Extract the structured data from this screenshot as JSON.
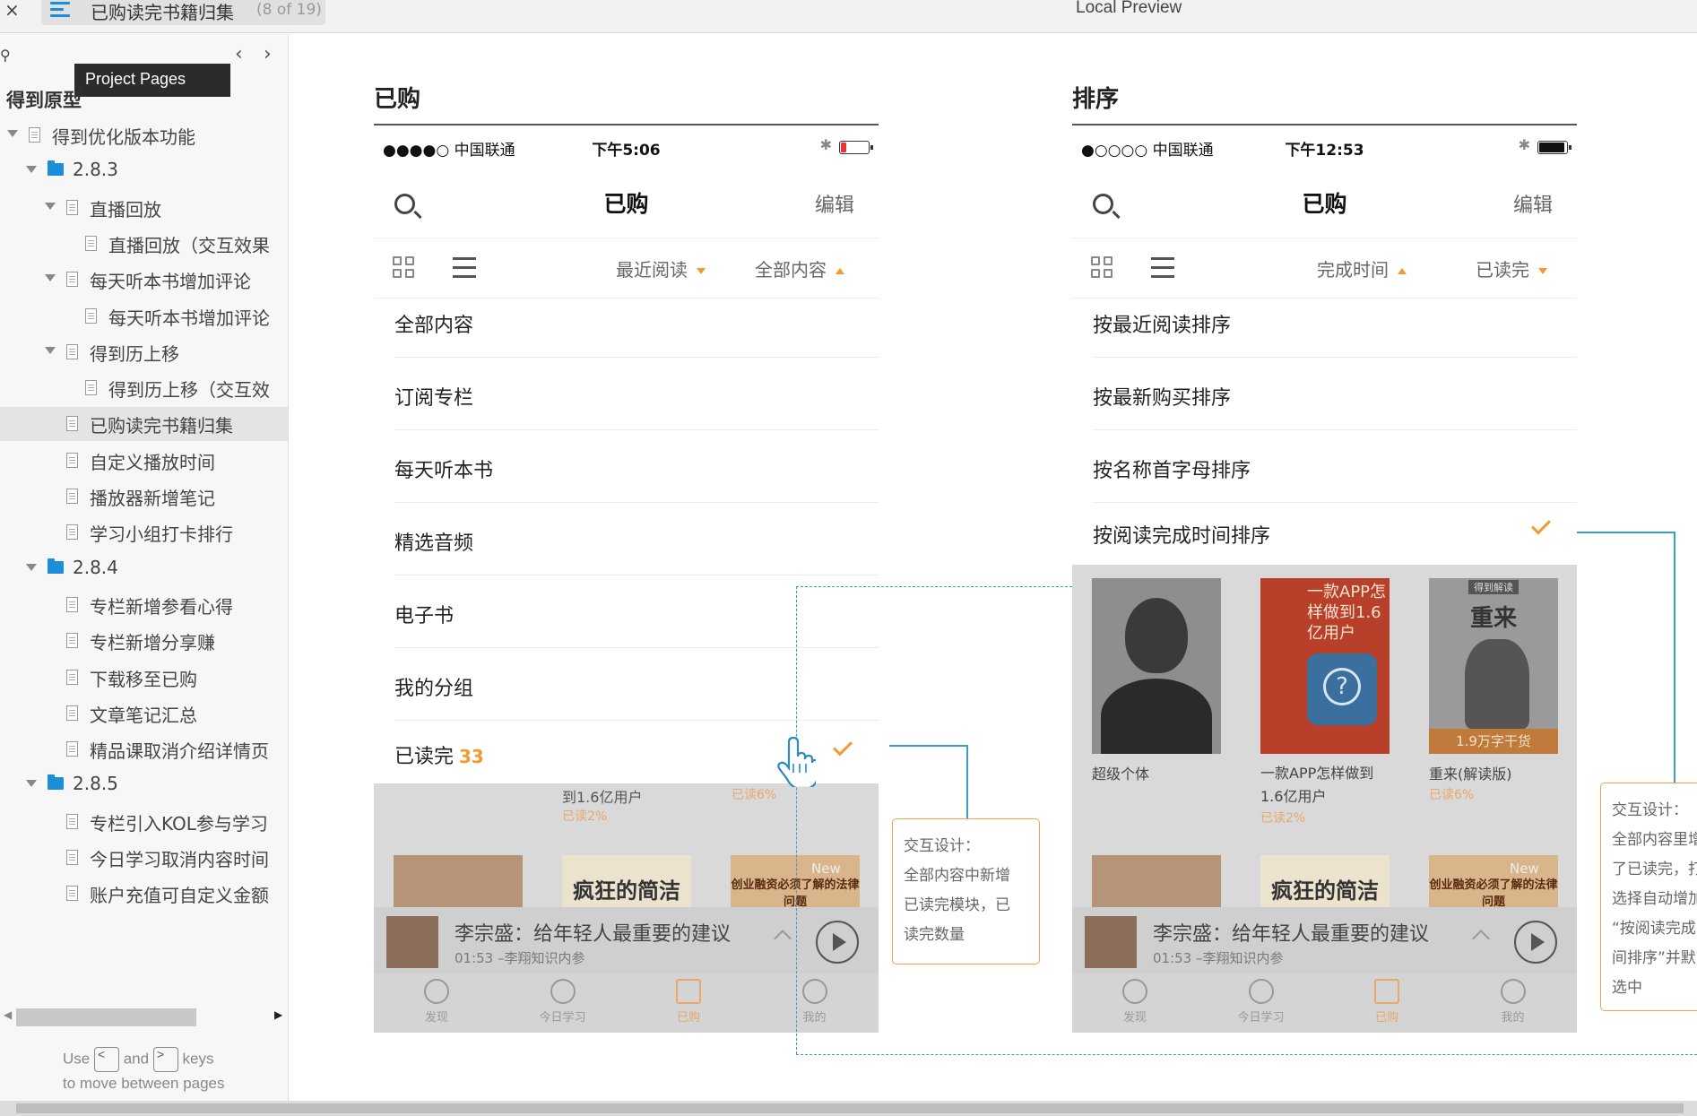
{
  "window": {
    "close_glyph": "×",
    "title": "已购读完书籍归集",
    "page_count": "(8 of 19)",
    "preview_label": "Local Preview"
  },
  "sidebar": {
    "tooltip": "Project Pages",
    "root_title": "得到原型",
    "hint_use": "Use",
    "hint_and": "and",
    "hint_keys": "keys",
    "hint_line2": "to move between pages",
    "items": [
      {
        "label": "得到优化版本功能",
        "type": "page",
        "level": 0,
        "expanded": true
      },
      {
        "label": "2.8.3",
        "type": "folder",
        "level": 1,
        "expanded": true
      },
      {
        "label": "直播回放",
        "type": "page",
        "level": 2,
        "expanded": true
      },
      {
        "label": "直播回放（交互效果",
        "type": "page",
        "level": 3
      },
      {
        "label": "每天听本书增加评论",
        "type": "page",
        "level": 2,
        "expanded": true
      },
      {
        "label": "每天听本书增加评论",
        "type": "page",
        "level": 3
      },
      {
        "label": "得到历上移",
        "type": "page",
        "level": 2,
        "expanded": true
      },
      {
        "label": "得到历上移（交互效",
        "type": "page",
        "level": 3
      },
      {
        "label": "已购读完书籍归集",
        "type": "page",
        "level": 2,
        "selected": true
      },
      {
        "label": "自定义播放时间",
        "type": "page",
        "level": 2
      },
      {
        "label": "播放器新增笔记",
        "type": "page",
        "level": 2
      },
      {
        "label": "学习小组打卡排行",
        "type": "page",
        "level": 2
      },
      {
        "label": "2.8.4",
        "type": "folder",
        "level": 1,
        "expanded": true
      },
      {
        "label": "专栏新增参看心得",
        "type": "page",
        "level": 2
      },
      {
        "label": "专栏新增分享赚",
        "type": "page",
        "level": 2
      },
      {
        "label": "下载移至已购",
        "type": "page",
        "level": 2
      },
      {
        "label": "文章笔记汇总",
        "type": "page",
        "level": 2
      },
      {
        "label": "精品课取消介绍详情页",
        "type": "page",
        "level": 2
      },
      {
        "label": "2.8.5",
        "type": "folder",
        "level": 1,
        "expanded": true
      },
      {
        "label": "专栏引入KOL参与学习",
        "type": "page",
        "level": 2
      },
      {
        "label": "今日学习取消内容时间",
        "type": "page",
        "level": 2
      },
      {
        "label": "账户充值可自定义金额",
        "type": "page",
        "level": 2
      }
    ]
  },
  "left": {
    "section_title": "已购",
    "carrier": "●●●●○ 中国联通",
    "time": "下午5:06",
    "battery_level": 0.2,
    "battery_color": "#e8353b",
    "nav_title": "已购",
    "nav_edit": "编辑",
    "filter1": "最近阅读",
    "filter2": "全部内容",
    "menu": [
      {
        "label": "全部内容"
      },
      {
        "label": "订阅专栏"
      },
      {
        "label": "每天听本书"
      },
      {
        "label": "精选音频"
      },
      {
        "label": "电子书"
      },
      {
        "label": "我的分组"
      }
    ],
    "read_done": "已读完",
    "read_count": "33",
    "ov_line1": "到1.6亿用户",
    "ov_read1": "已读2%",
    "ov_read2": "已读6%",
    "ov_c2": "疯狂的简洁",
    "ov_c3": "创业融资必须了解的法律问题",
    "ov_new": "New",
    "player_title": "李宗盛：给年轻人最重要的建议",
    "player_sub": "01:53  –李翔知识内参",
    "tabs": [
      "发现",
      "今日学习",
      "已购",
      "我的"
    ]
  },
  "right": {
    "section_title": "排序",
    "carrier": "●○○○○ 中国联通",
    "time": "下午12:53",
    "battery_level": 0.95,
    "battery_color": "#111111",
    "nav_title": "已购",
    "nav_edit": "编辑",
    "filter1": "完成时间",
    "filter2": "已读完",
    "menu": [
      {
        "label": "按最近阅读排序"
      },
      {
        "label": "按最新购买排序"
      },
      {
        "label": "按名称首字母排序"
      }
    ],
    "selected_sort": "按阅读完成时间排序",
    "books": [
      {
        "title": "超级个体",
        "sub": ""
      },
      {
        "title": "一款APP怎样做到1.6亿用户",
        "sub": "已读2%",
        "cover_text": "一款APP怎样做到1.6亿用户"
      },
      {
        "title": "重来(解读版)",
        "sub": "已读6%",
        "cover_text": "重来",
        "cover_tag": "得到解读",
        "cover_foot": "1.9万字干货"
      }
    ],
    "ov_c2": "疯狂的简洁",
    "ov_c3": "创业融资必须了解的法律问题",
    "ov_new": "New",
    "player_title": "李宗盛：给年轻人最重要的建议",
    "player_sub": "01:53  –李翔知识内参",
    "tabs": [
      "发现",
      "今日学习",
      "已购",
      "我的"
    ]
  },
  "annotations": {
    "left": "交互设计：\n全部内容中新增\n已读完模块，已\n读完数量",
    "right": "交互设计：\n全部内容里增\n了已读完，打\n选择自动增加\n“按阅读完成\n间排序”并默\n选中"
  },
  "colors": {
    "accent": "#f29a2f",
    "link": "#3a9fc7",
    "folder": "#1a8ed8"
  }
}
